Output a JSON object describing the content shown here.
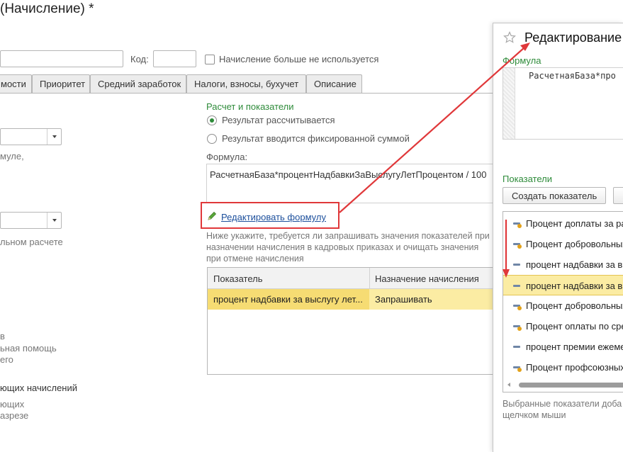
{
  "window": {
    "title": "(Начисление) *"
  },
  "header": {
    "code_label": "Код:",
    "code_value": "",
    "name_value": "",
    "not_used_label": "Начисление больше не используется"
  },
  "tabs": [
    {
      "label": "мости"
    },
    {
      "label": "Приоритет"
    },
    {
      "label": "Средний заработок"
    },
    {
      "label": "Налоги, взносы, бухучет"
    },
    {
      "label": "Описание"
    }
  ],
  "left_panel": {
    "text_1": "муле,",
    "text_2": "льном расчете",
    "text_3": "в",
    "text_4": "ьная помощь",
    "text_5": "его",
    "text_6": "ющих начислений",
    "text_7": "ющих",
    "text_8": "азрезе"
  },
  "calc": {
    "section_title": "Расчет и показатели",
    "radio_calculated": "Результат рассчитывается",
    "radio_fixed": "Результат вводится фиксированной суммой",
    "formula_label": "Формула:",
    "formula_text": "РасчетнаяБаза*процентНадбавкиЗаВыслугуЛетПроцентом / 100",
    "edit_formula_link": "Редактировать формулу",
    "hint": "Ниже укажите, требуется ли запрашивать значения показателей при назначении начисления в кадровых приказах и очищать значения при отмене начисления"
  },
  "indicators_table": {
    "columns": [
      "Показатель",
      "Назначение начисления"
    ],
    "rows": [
      {
        "indicator": "процент надбавки за выслугу лет...",
        "assignment": "Запрашивать"
      }
    ]
  },
  "dialog": {
    "title": "Редактирование",
    "formula_label": "Формула",
    "formula_text": "РасчетнаяБаза*про",
    "indicators_label": "Показатели",
    "create_button": "Создать показатель",
    "items": [
      {
        "label": "Процент доплаты за ра",
        "icon": "indicator-shared-icon"
      },
      {
        "label": "Процент добровольных",
        "icon": "indicator-shared-icon"
      },
      {
        "label": "процент надбавки за вы",
        "icon": "indicator-icon"
      },
      {
        "label": "процент надбавки за вы",
        "icon": "indicator-icon"
      },
      {
        "label": "Процент добровольных",
        "icon": "indicator-shared-icon"
      },
      {
        "label": "Процент оплаты по сре",
        "icon": "indicator-shared-icon"
      },
      {
        "label": "процент премии ежеме",
        "icon": "indicator-icon"
      },
      {
        "label": "Процент профсоюзных",
        "icon": "indicator-shared-icon"
      }
    ],
    "footer_hint_1": "Выбранные показатели доба",
    "footer_hint_2": "щелчком мыши"
  },
  "colors": {
    "accent_green": "#2e8b3a",
    "highlight": "#e0383a",
    "selected_row": "#fbeca3",
    "link": "#1c4f9c"
  }
}
